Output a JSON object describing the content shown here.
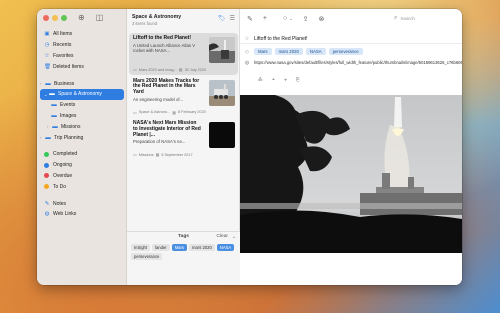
{
  "sidebar": {
    "items": [
      {
        "label": "All Items",
        "icon": "tray-icon"
      },
      {
        "label": "Recents",
        "icon": "clock-icon"
      },
      {
        "label": "Favorites",
        "icon": "star-icon"
      },
      {
        "label": "Deleted Items",
        "icon": "trash-icon"
      }
    ],
    "folders": [
      {
        "label": "Business",
        "icon": "folder-icon",
        "level": 0,
        "expanded": false
      },
      {
        "label": "Space & Astronomy",
        "icon": "folder-icon",
        "level": 0,
        "expanded": true,
        "selected": true
      },
      {
        "label": "Events",
        "icon": "folder-icon",
        "level": 1
      },
      {
        "label": "Images",
        "icon": "folder-icon",
        "level": 1
      },
      {
        "label": "Missions",
        "icon": "folder-icon",
        "level": 1,
        "expanded": false
      },
      {
        "label": "Trip Planning",
        "icon": "folder-icon",
        "level": 0,
        "expanded": false
      }
    ],
    "statuses": [
      {
        "label": "Completed",
        "color": "#34c759"
      },
      {
        "label": "Ongoing",
        "color": "#2f7de1"
      },
      {
        "label": "Overdue",
        "color": "#e5484d"
      },
      {
        "label": "To Do",
        "color": "#f5a623"
      }
    ],
    "types": [
      {
        "label": "Notes",
        "icon": "note-icon"
      },
      {
        "label": "Web Links",
        "icon": "globe-icon"
      }
    ]
  },
  "list": {
    "title": "Space & Astronomy",
    "subtitle": "3 items found",
    "cards": [
      {
        "title": "Liftoff to the Red Planet!",
        "desc": "A United Launch Alliance Atlas V rocket with NASA...",
        "folder": "Mars 2020 and Imag...",
        "date": "30 July 2020",
        "thumb": "rocket"
      },
      {
        "title": "Mars 2020 Makes Tracks for the Red Planet in the Mars Yard",
        "desc": "An engineering model of...",
        "folder": "Space & Astrono...",
        "date": "8 February 2020",
        "thumb": "rover"
      },
      {
        "title": "NASA's Next Mars Mission to Investigate Interior of Red Planet |...",
        "desc": "Preparation of NASA's ne...",
        "folder": "Missions",
        "date": "6 September 2017",
        "thumb": "dark"
      }
    ]
  },
  "tags": {
    "title": "Tags",
    "clear": "Clear",
    "items": [
      {
        "label": "InSight",
        "active": false
      },
      {
        "label": "lander",
        "active": false
      },
      {
        "label": "Mars",
        "active": true
      },
      {
        "label": "mars 2020",
        "active": false
      },
      {
        "label": "NASA",
        "active": true
      },
      {
        "label": "perseverance",
        "active": false
      }
    ]
  },
  "detail": {
    "search_placeholder": "Search",
    "title": "Liftoff to the Red Planet!",
    "tags": [
      "Mars",
      "mars 2020",
      "NASA",
      "perseverance"
    ],
    "url": "https://www.nasa.gov/sites/default/files/styles/full_width_feature/public/thumbnails/image/50169613626_c76b6060d6_k.jpg"
  }
}
